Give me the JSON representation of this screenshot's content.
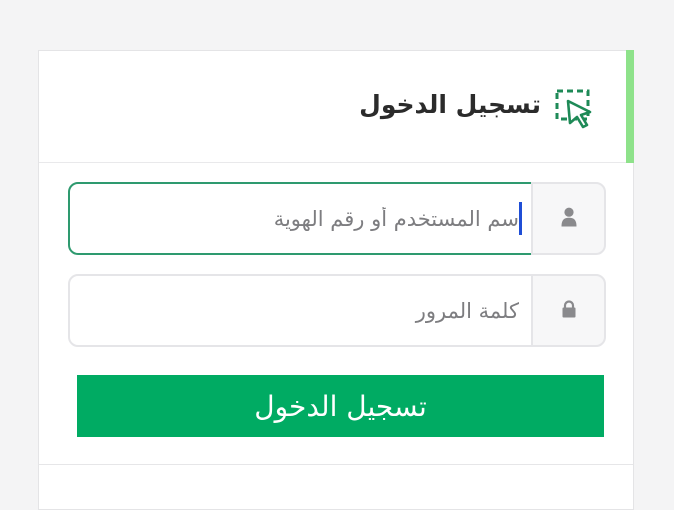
{
  "login_card": {
    "title": "تسجيل الدخول",
    "header_icon": "select-cursor-icon",
    "accent_color": "#8ee28a",
    "username": {
      "icon": "user-icon",
      "placeholder": "سم المستخدم أو رقم الهوية",
      "value": ""
    },
    "password": {
      "icon": "lock-icon",
      "placeholder": "كلمة المرور",
      "value": ""
    },
    "submit_label": "تسجيل الدخول",
    "submit_color": "#00ab63"
  }
}
